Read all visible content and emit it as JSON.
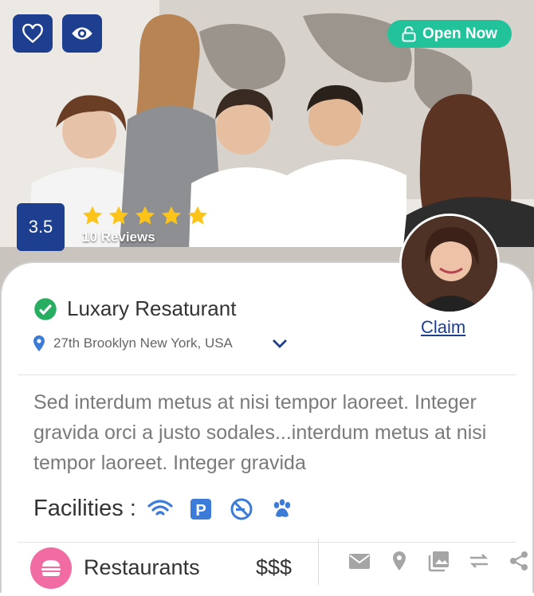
{
  "listing": {
    "title": "Luxary Resaturant",
    "address": "27th Brooklyn New York, USA",
    "status": "Open Now",
    "rating": "3.5",
    "stars": 5,
    "reviews": "10 Reviews",
    "claim": "Claim",
    "description": "Sed interdum metus at nisi tempor laoreet. Integer gravida orci a justo sodales...interdum metus at nisi tempor laoreet. Integer gravida",
    "facilities_label": "Facilities :",
    "facilities": [
      "wifi-icon",
      "parking-icon",
      "no-smoking-icon",
      "pets-icon"
    ],
    "category": "Restaurants",
    "price": "$$$"
  },
  "actions": [
    "mail-icon",
    "location-icon",
    "gallery-icon",
    "compare-icon",
    "share-icon"
  ],
  "colors": {
    "primary": "#1e3f8f",
    "open": "#22c39b",
    "star": "#fcc419",
    "verified": "#27ae60",
    "category": "#f06ca3",
    "facility": "#3d7bd9",
    "action_icon": "#a5a5a5",
    "text_dark": "#333333",
    "text_muted": "#7a7a7a"
  }
}
